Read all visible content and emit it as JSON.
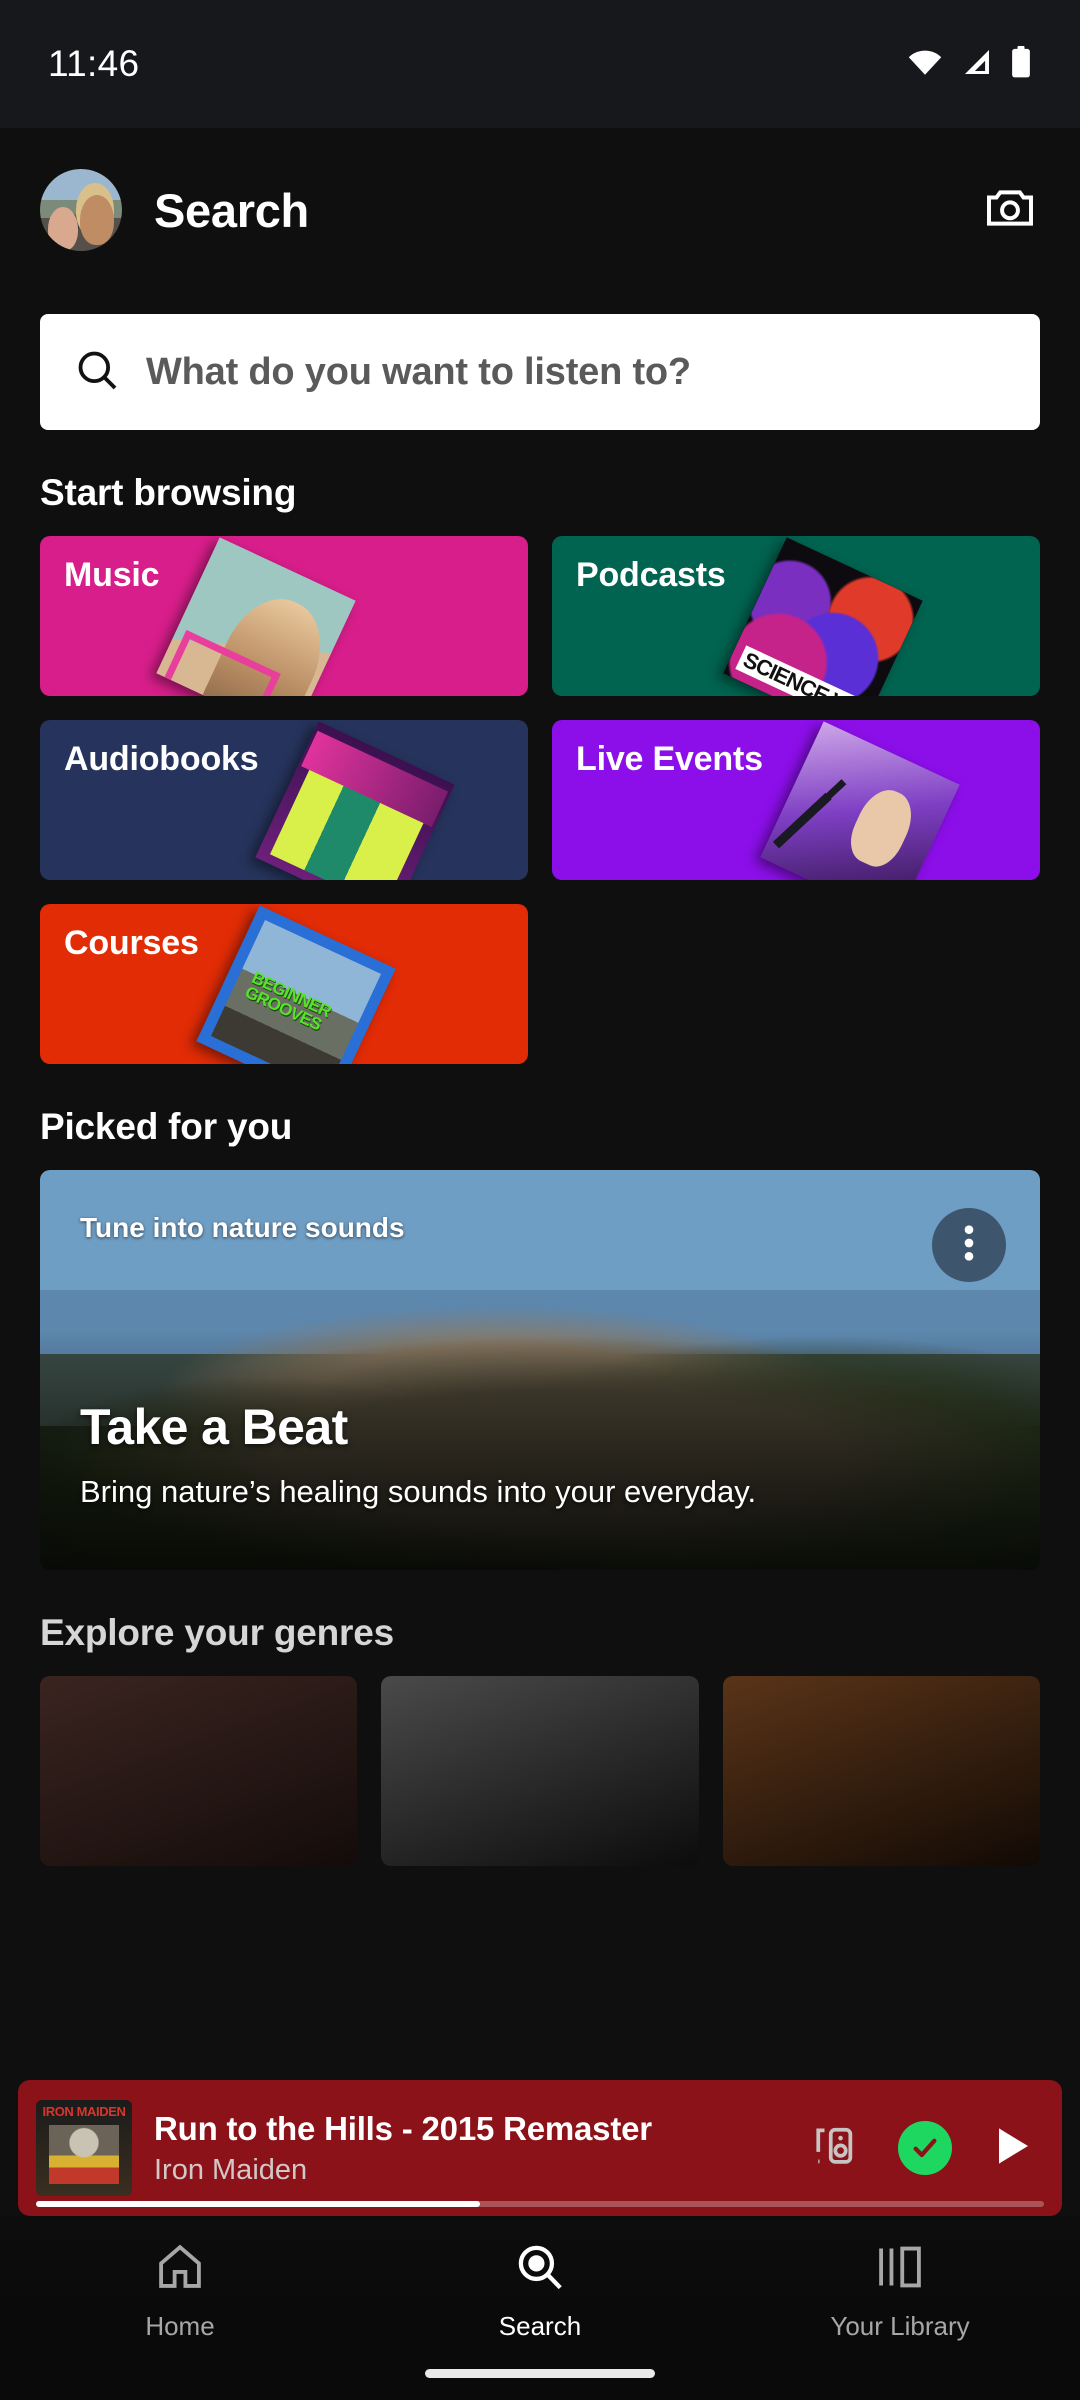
{
  "status_bar": {
    "time": "11:46",
    "icons": [
      "wifi-icon",
      "cellular-icon",
      "battery-icon"
    ]
  },
  "header": {
    "title": "Search",
    "avatar_name": "user-avatar",
    "camera_icon": "camera-icon"
  },
  "search": {
    "placeholder": "What do you want to listen to?",
    "value": "",
    "icon": "search-icon"
  },
  "sections": {
    "start_browsing": "Start browsing",
    "picked_for_you": "Picked for you",
    "explore_genres": "Explore your genres"
  },
  "browse_categories": [
    {
      "label": "Music",
      "color": "#d81e8b"
    },
    {
      "label": "Podcasts",
      "color": "#006450"
    },
    {
      "label": "Audiobooks",
      "color": "#26335c"
    },
    {
      "label": "Live Events",
      "color": "#8c0fea"
    },
    {
      "label": "Courses",
      "color": "#e22c06"
    }
  ],
  "picked": {
    "eyebrow": "Tune into nature sounds",
    "title": "Take a Beat",
    "subtitle": "Bring nature’s healing sounds into your everyday.",
    "menu_icon": "overflow-menu-icon"
  },
  "now_playing": {
    "title": "Run to the Hills - 2015 Remaster",
    "artist": "Iron Maiden",
    "background_color": "#8a1218",
    "accent_color": "#1ed760",
    "progress_percent": 44,
    "connect_icon": "devices-icon",
    "saved_icon": "check-circle-icon",
    "play_icon": "play-icon"
  },
  "bottom_nav": [
    {
      "label": "Home",
      "icon": "home-icon",
      "active": false
    },
    {
      "label": "Search",
      "icon": "search-icon",
      "active": true
    },
    {
      "label": "Your Library",
      "icon": "library-icon",
      "active": false
    }
  ]
}
